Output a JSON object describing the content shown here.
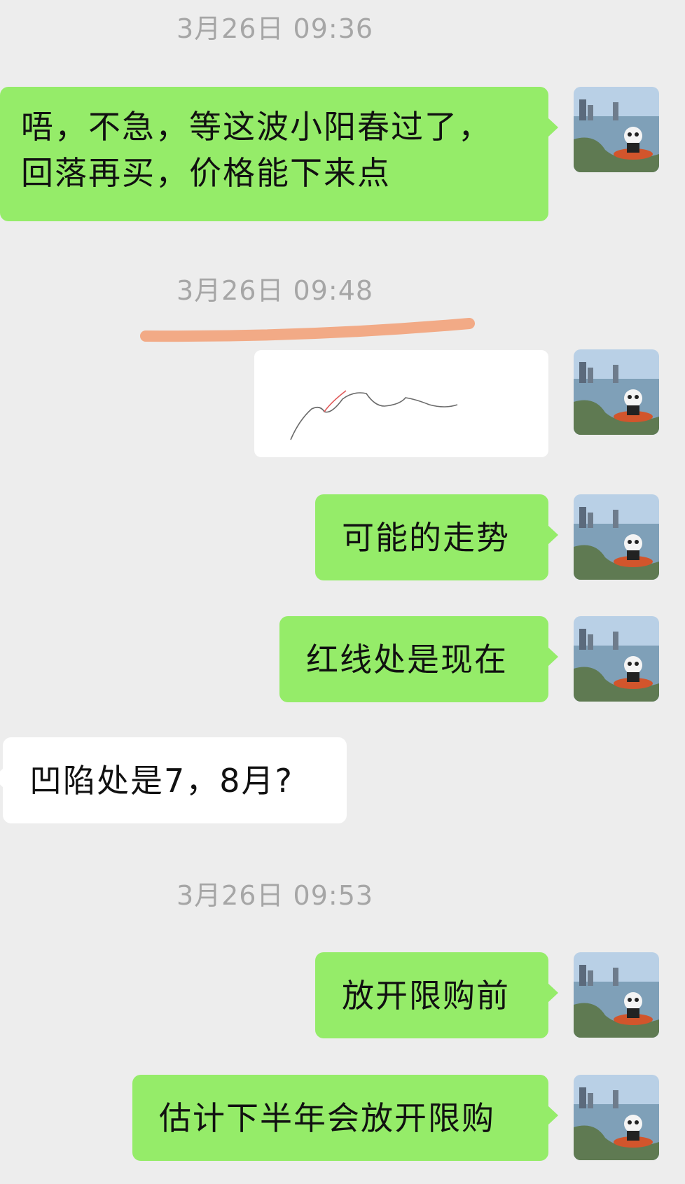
{
  "chat": {
    "timestamps": [
      "3月26日 09:36",
      "3月26日 09:48",
      "3月26日 09:53"
    ],
    "messages": [
      {
        "side": "out",
        "lines": [
          "唔，不急，等这波小阳春过了，",
          "回落再买，价格能下来点"
        ]
      },
      {
        "side": "out",
        "type": "image",
        "image_name": "hand-drawn-trend-sketch"
      },
      {
        "side": "out",
        "text": "可能的走势"
      },
      {
        "side": "out",
        "text": "红线处是现在"
      },
      {
        "side": "in",
        "text": "凹陷处是7，8月?"
      },
      {
        "side": "out",
        "text": "放开限购前"
      },
      {
        "side": "out",
        "text": "估计下半年会放开限购"
      }
    ]
  },
  "colors": {
    "background": "#ededed",
    "outgoing_bubble": "#95ec69",
    "incoming_bubble": "#ffffff",
    "timestamp_text": "#a6a6a6",
    "highlight_stroke": "#f29d73",
    "sketch_line": "#6b6b6b",
    "sketch_red": "#e05a5a"
  },
  "icons": {
    "avatar": "avatar-landscape-panda-icon"
  }
}
